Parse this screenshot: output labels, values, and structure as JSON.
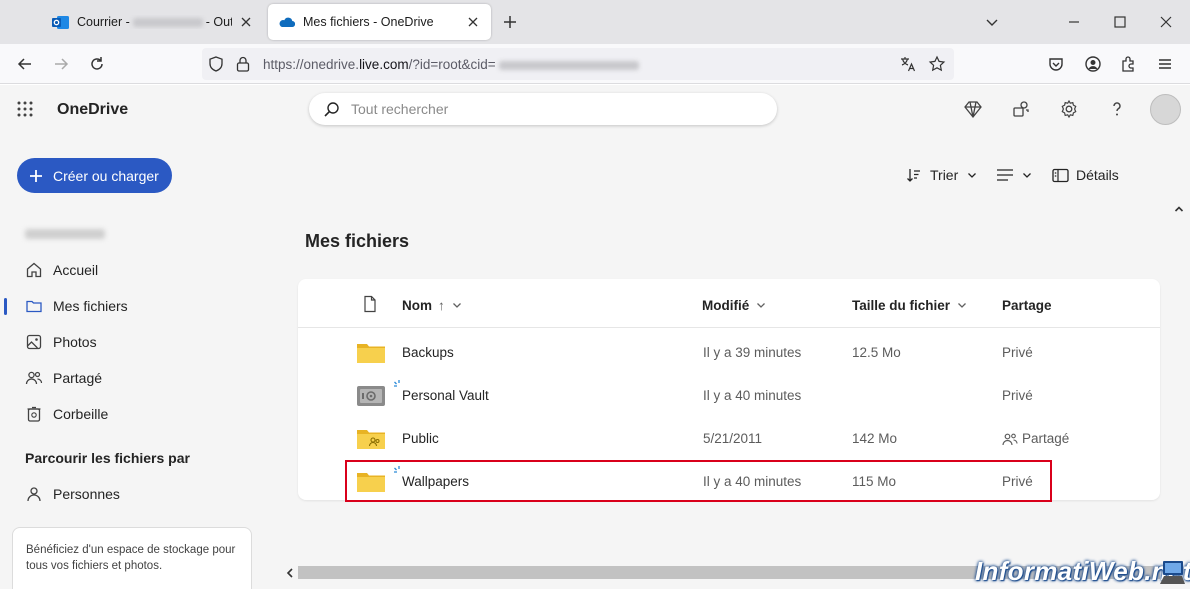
{
  "browser": {
    "tabs": [
      {
        "title": "Courrier -",
        "title_suffix": "- Outloo"
      },
      {
        "title": "Mes fichiers - OneDrive"
      }
    ],
    "url_prefix": "https://onedrive.",
    "url_host": "live.com",
    "url_path": "/?id=root&cid="
  },
  "app": {
    "name": "OneDrive",
    "search_placeholder": "Tout rechercher",
    "create_label": "Créer ou charger",
    "page_title": "Mes fichiers"
  },
  "sidebar": {
    "items": [
      {
        "label": "Accueil"
      },
      {
        "label": "Mes fichiers",
        "selected": true
      },
      {
        "label": "Photos"
      },
      {
        "label": "Partagé"
      },
      {
        "label": "Corbeille"
      }
    ],
    "section_title": "Parcourir les fichiers par",
    "people_label": "Personnes",
    "promo_text": "Bénéficiez d'un espace de stockage pour tous vos fichiers et photos."
  },
  "commands": {
    "sort_label": "Trier",
    "details_label": "Détails"
  },
  "table": {
    "columns": {
      "name": "Nom",
      "name_sort_arrow": "↑",
      "modified": "Modifié",
      "size": "Taille du fichier",
      "sharing": "Partage"
    },
    "rows": [
      {
        "name": "Backups",
        "modified": "Il y a 39 minutes",
        "size": "12.5 Mo",
        "sharing": "Privé",
        "icon": "folder-icon"
      },
      {
        "name": "Personal Vault",
        "modified": "Il y a 40 minutes",
        "size": "",
        "sharing": "Privé",
        "icon": "vault-icon"
      },
      {
        "name": "Public",
        "modified": "5/21/2011",
        "size": "142 Mo",
        "sharing": "Partagé",
        "icon": "shared-folder-icon"
      },
      {
        "name": "Wallpapers",
        "modified": "Il y a 40 minutes",
        "size": "115 Mo",
        "sharing": "Privé",
        "icon": "folder-icon"
      }
    ]
  },
  "watermark": "InformatiWeb.net",
  "colors": {
    "accent": "#2b59c3",
    "folder": "#f5c842",
    "highlight": "#d9001b"
  }
}
